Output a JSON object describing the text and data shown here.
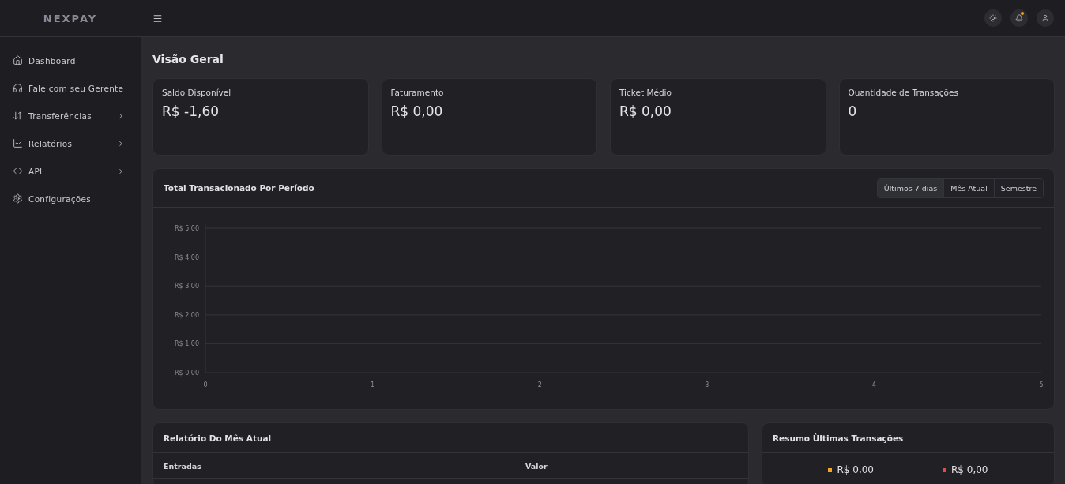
{
  "logo": {
    "text": "NEXPAY"
  },
  "sidebar": {
    "items": [
      {
        "label": "Dashboard",
        "expandable": false
      },
      {
        "label": "Fale com seu Gerente",
        "expandable": false
      },
      {
        "label": "Transferências",
        "expandable": true
      },
      {
        "label": "Relatórios",
        "expandable": true
      },
      {
        "label": "API",
        "expandable": true
      },
      {
        "label": "Configurações",
        "expandable": false
      }
    ]
  },
  "topbar": {
    "notification_dot": true
  },
  "page_title": "Visão Geral",
  "stats": [
    {
      "label": "Saldo Disponível",
      "value": "R$ -1,60"
    },
    {
      "label": "Faturamento",
      "value": "R$ 0,00"
    },
    {
      "label": "Ticket Médio",
      "value": "R$ 0,00"
    },
    {
      "label": "Quantidade de Transações",
      "value": "0"
    }
  ],
  "chart_card": {
    "title": "Total Transacionado Por Período",
    "tabs": [
      {
        "label": "Últimos 7 dias",
        "selected": true
      },
      {
        "label": "Mês Atual",
        "selected": false
      },
      {
        "label": "Semestre",
        "selected": false
      }
    ],
    "axes": {
      "x_labels": [
        "0",
        "1",
        "2",
        "3",
        "4",
        "5"
      ],
      "y_labels": [
        "R$ 5,00",
        "R$ 4,00",
        "R$ 3,00",
        "R$ 2,00",
        "R$ 1,00",
        "R$ 0,00"
      ]
    }
  },
  "report": {
    "title": "Relatório Do Mês Atual",
    "columns": [
      "Entradas",
      "Valor"
    ]
  },
  "summary": {
    "title": "Resumo Ùltimas Transações",
    "items": [
      {
        "value": "R$ 0,00",
        "color": "#f5a524"
      },
      {
        "value": "R$ 0,00",
        "color": "#e5484d"
      }
    ]
  }
}
